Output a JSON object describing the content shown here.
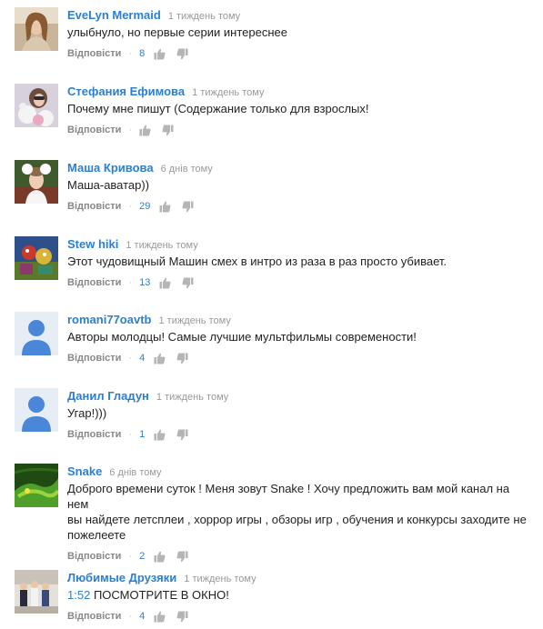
{
  "comments": [
    {
      "author": "EveLyn Mermaid",
      "time": "1 тиждень тому",
      "text": "улыбнуло, но первые серии интереснее",
      "reply": "Відповісти",
      "likes": "8"
    },
    {
      "author": "Стефания Ефимова",
      "time": "1 тиждень тому",
      "text": "Почему мне пишут (Содержание только для взрослых!",
      "reply": "Відповісти",
      "likes": ""
    },
    {
      "author": "Маша Кривова",
      "time": "6 днів тому",
      "text": "Маша-аватар))",
      "reply": "Відповісти",
      "likes": "29"
    },
    {
      "author": "Stew hiki",
      "time": "1 тиждень тому",
      "text": "Этот чудовищный Машин смех в интро из раза в раз просто убивает.",
      "reply": "Відповісти",
      "likes": "13"
    },
    {
      "author": "romani77oavtb",
      "time": "1 тиждень тому",
      "text": "Авторы молодцы! Самые лучшие мультфильмы современости!",
      "reply": "Відповісти",
      "likes": "4"
    },
    {
      "author": "Данил Гладун",
      "time": "1 тиждень тому",
      "text": "Угар!)))",
      "reply": "Відповісти",
      "likes": "1"
    },
    {
      "author": "Snake",
      "time": "6 днів тому",
      "text_lines": [
        "Доброго времени суток ! Меня зовут Snake ! Хочу предложить вам мой канал на нем",
        "вы найдете летсплеи , хоррор игры , обзоры игр , обучения и конкурсы заходите не",
        "пожелеете"
      ],
      "reply": "Відповісти",
      "likes": "2"
    },
    {
      "author": "Любимые Друзяки",
      "time": "1 тиждень тому",
      "timestamp_link": "1:52",
      "text": "ПОСМОТРИТЕ В ОКНО!",
      "reply": "Відповісти",
      "likes": "4"
    }
  ],
  "separator": "·",
  "icons": {
    "like": "thumbs-up-icon",
    "dislike": "thumbs-down-icon",
    "default_avatar": "default-user-avatar"
  },
  "colors": {
    "author": "#2c7fd0",
    "meta": "#999999",
    "default_avatar_bg": "#e6edf5",
    "default_avatar_fg": "#4a87d8"
  }
}
